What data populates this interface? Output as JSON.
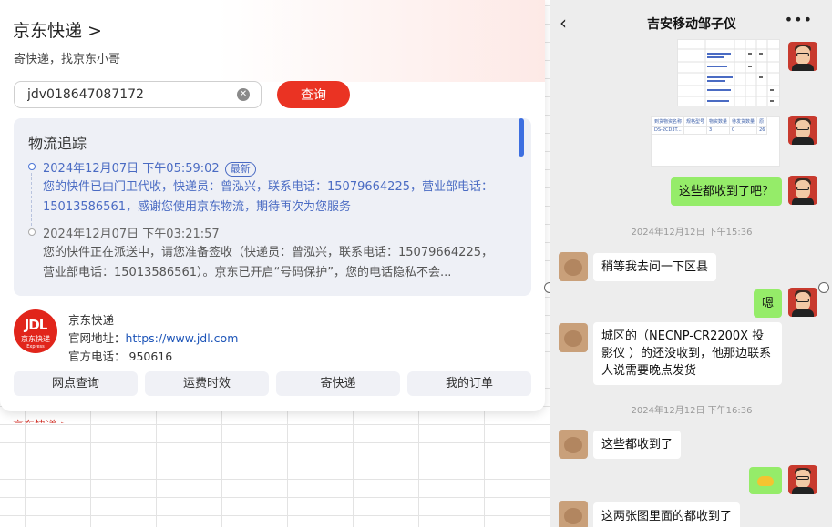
{
  "jd": {
    "title": "京东快递 >",
    "subtitle": "寄快递，找京东小哥",
    "search_value": "jdv018647087172",
    "query_label": "查询",
    "tracking_title": "物流追踪",
    "events": [
      {
        "time": "2024年12月07日 下午05:59:02",
        "badge": "最新",
        "desc": "您的快件已由门卫代收，快递员：曾泓兴，联系电话：15079664225，营业部电话：15013586561，感谢您使用京东物流，期待再次为您服务"
      },
      {
        "time": "2024年12月07日 下午03:21:57",
        "desc": "您的快件正在派送中，请您准备签收（快递员：曾泓兴，联系电话：15079664225，营业部电话：15013586561）。京东已开启“号码保护”，您的电话隐私不会..."
      }
    ],
    "logo": {
      "l1": "JDL",
      "l2": "京东快递",
      "l3": "Express"
    },
    "company": "京东快递",
    "site_label": "官网地址：",
    "site_url": "https://www.jdl.com",
    "phone_label": "官方电话：",
    "phone": "950616",
    "actions": [
      "网点查询",
      "运费时效",
      "寄快递",
      "我的订单"
    ],
    "peek_text": "京东快递 >"
  },
  "chat": {
    "title": "吉安移动邹子仪",
    "back_icon": "chevron-left-icon",
    "more_icon": "more-icon",
    "messages": {
      "m3": "这些都收到了吧？",
      "ts1": "2024年12月12日 下午15:36",
      "m4": "稍等我去问一下区县",
      "m5": "嗯",
      "m6": "城区的（NECNP-CR2200X 投影仪 ）的还没收到，他那边联系人说需要晚点发货",
      "ts2": "2024年12月12日 下午16:36",
      "m7": "这些都收到了",
      "m9": "这两张图里面的都收到了"
    },
    "img2_headers": [
      "到货物资名称",
      "规格型号",
      "物资数量",
      "待发货数量",
      "原"
    ],
    "img2_row": [
      "DS-2CD3T...",
      "",
      "3",
      "0",
      "26"
    ]
  },
  "colors": {
    "jd_red": "#ea3323",
    "link_blue": "#1c54b8",
    "track_blue": "#4a6bc3",
    "chat_green": "#95ec69",
    "chat_bg": "#ededed"
  }
}
